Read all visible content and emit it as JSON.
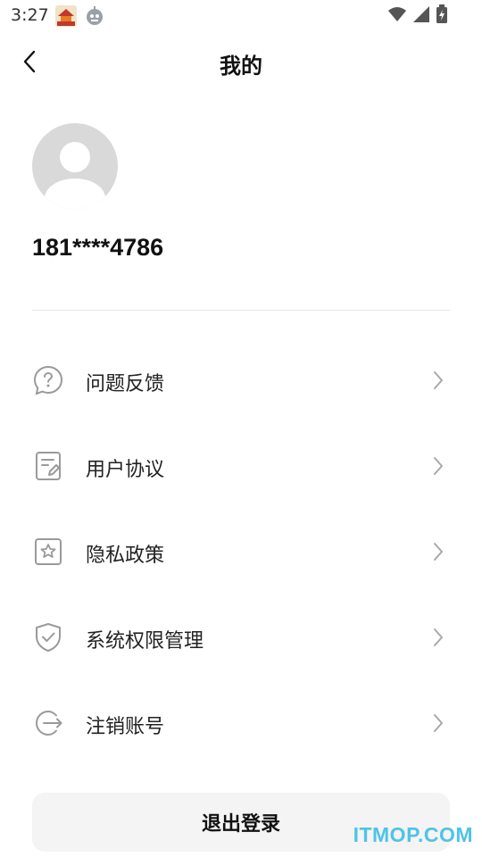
{
  "status_bar": {
    "time": "3:27",
    "icons": [
      "app-notification-icon",
      "robot-notification-icon",
      "wifi-icon",
      "signal-icon",
      "battery-icon"
    ]
  },
  "nav": {
    "title": "我的",
    "back_icon": "chevron-left-icon"
  },
  "profile": {
    "avatar_icon": "default-avatar-icon",
    "phone": "181****4786"
  },
  "menu": {
    "items": [
      {
        "label": "问题反馈",
        "icon": "question-icon"
      },
      {
        "label": "用户协议",
        "icon": "document-edit-icon"
      },
      {
        "label": "隐私政策",
        "icon": "star-badge-icon"
      },
      {
        "label": "系统权限管理",
        "icon": "shield-check-icon"
      },
      {
        "label": "注销账号",
        "icon": "logout-arrow-icon"
      }
    ],
    "chevron_icon": "chevron-right-icon"
  },
  "logout": {
    "label": "退出登录"
  },
  "watermark": {
    "text": "ITMOP.COM"
  },
  "colors": {
    "background": "#ffffff",
    "text_primary": "#111111",
    "divider": "#e6e6e6",
    "button_bg": "#f4f4f4",
    "icon_gray": "#9a9a9a",
    "avatar_bg": "#d9d9d9",
    "watermark": "#4fc3e8"
  }
}
